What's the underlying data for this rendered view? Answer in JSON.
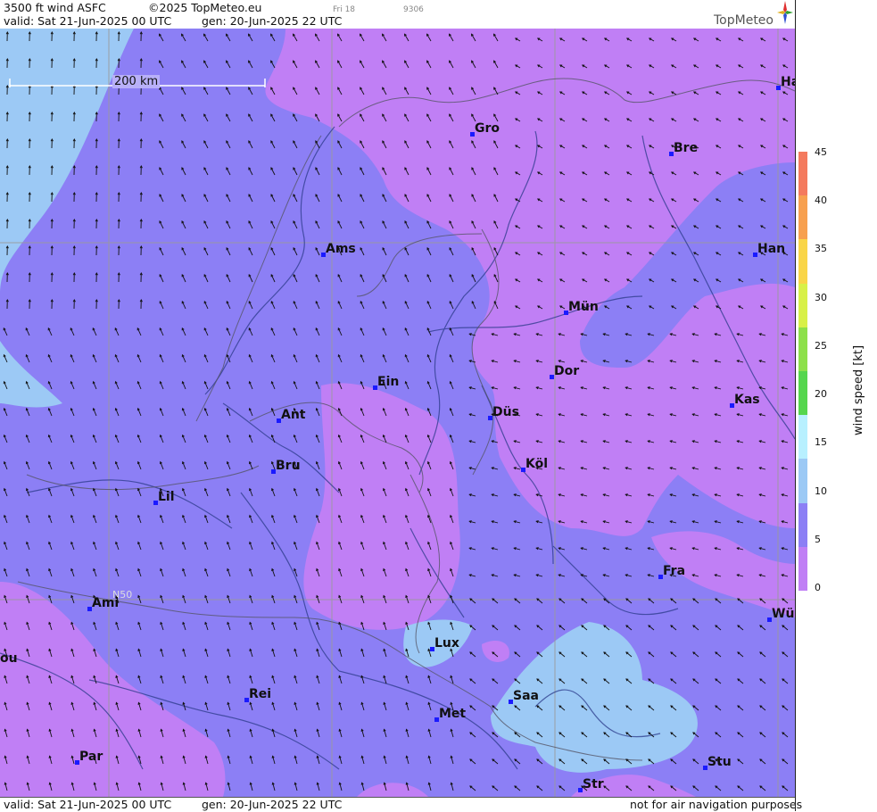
{
  "header": {
    "title": "3500 ft wind ASFC",
    "copyright": "©2025 TopMeteo.eu",
    "day_marker": "Fri 18",
    "code": "9306",
    "valid_line": "valid:  Sat  21-Jun-2025  00 UTC",
    "gen_line": "gen: 20-Jun-2025 22 UTC",
    "logo_text": "TopMeteo"
  },
  "footer": {
    "valid_line": "valid:  Sat  21-Jun-2025  00 UTC",
    "gen_line": "gen: 20-Jun-2025 22 UTC",
    "disclaimer": "not for air navigation purposes"
  },
  "scale": {
    "label": "200 km"
  },
  "grid_label": "N50",
  "legend": {
    "unit": "wind  speed  [kt]",
    "ticks": [
      "45",
      "40",
      "35",
      "30",
      "25",
      "20",
      "15",
      "10",
      "5",
      "0"
    ],
    "colors": [
      "#f47a5e",
      "#f7a050",
      "#f9d548",
      "#d8f048",
      "#8de04a",
      "#55d64e",
      "#b8f0ff",
      "#9cc9f5",
      "#8c7ff5",
      "#c07ff5"
    ]
  },
  "cities": [
    {
      "name": "Gro"
    },
    {
      "name": "Bre"
    },
    {
      "name": "Ha"
    },
    {
      "name": "Ams"
    },
    {
      "name": "Han"
    },
    {
      "name": "Mün"
    },
    {
      "name": "Dor"
    },
    {
      "name": "Ein"
    },
    {
      "name": "Kas"
    },
    {
      "name": "Ant"
    },
    {
      "name": "Düs"
    },
    {
      "name": "Bru"
    },
    {
      "name": "Köl"
    },
    {
      "name": "Lil"
    },
    {
      "name": "Fra"
    },
    {
      "name": "Ami"
    },
    {
      "name": "Wü"
    },
    {
      "name": "Lux"
    },
    {
      "name": "ou"
    },
    {
      "name": "Rei"
    },
    {
      "name": "Saa"
    },
    {
      "name": "Met"
    },
    {
      "name": "Par"
    },
    {
      "name": "Stu"
    },
    {
      "name": "Str"
    }
  ]
}
